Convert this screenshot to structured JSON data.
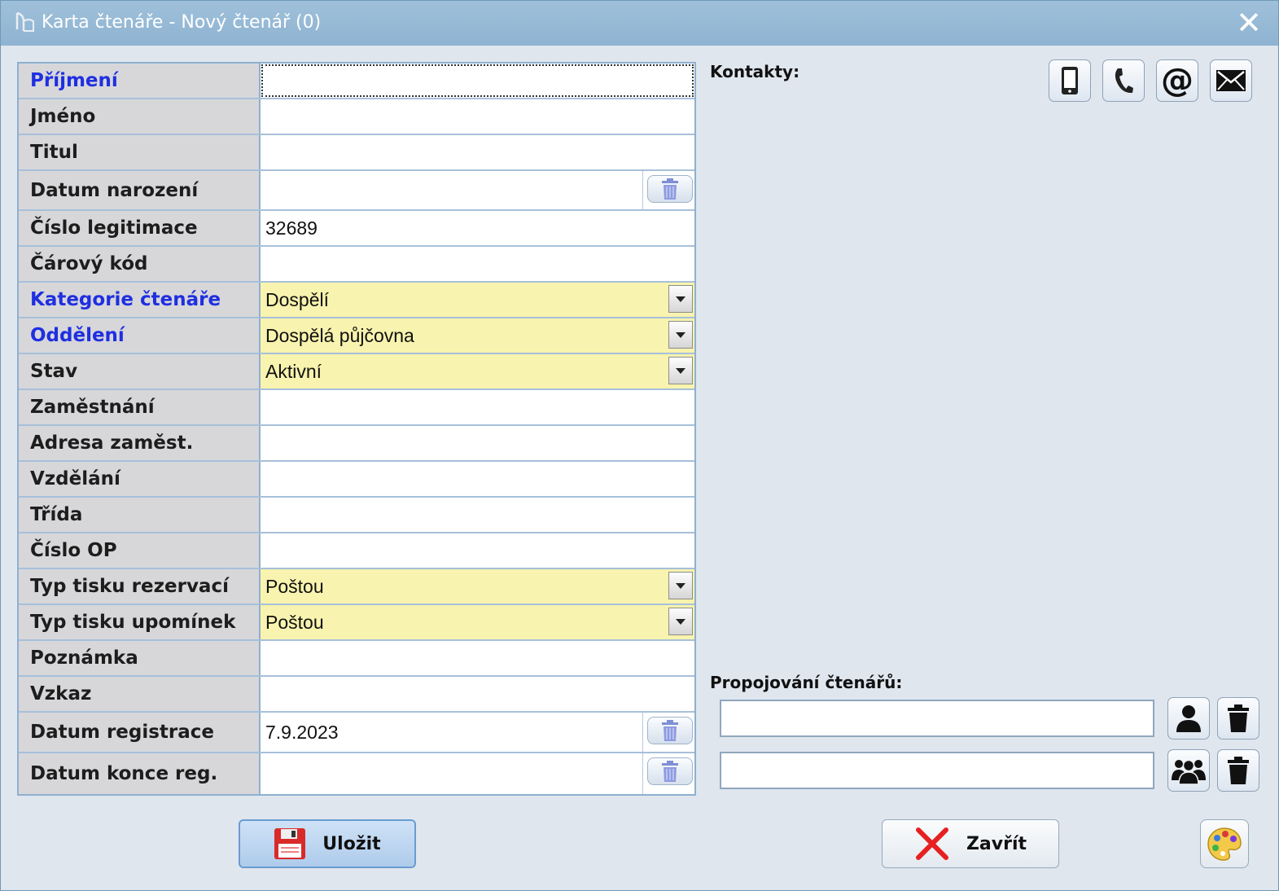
{
  "window": {
    "title": "Karta čtenáře - Nový čtenář (0)",
    "close_glyph": "✕"
  },
  "form": {
    "rows": [
      {
        "label": "Příjmení",
        "value": "",
        "required": true,
        "type": "text",
        "focused": true
      },
      {
        "label": "Jméno",
        "value": "",
        "type": "text"
      },
      {
        "label": "Titul",
        "value": "",
        "type": "text"
      },
      {
        "label": "Datum narození",
        "value": "",
        "type": "date"
      },
      {
        "label": "Číslo legitimace",
        "value": "32689",
        "type": "text"
      },
      {
        "label": "Čárový kód",
        "value": "",
        "type": "text"
      },
      {
        "label": "Kategorie čtenáře",
        "value": "Dospělí",
        "required": true,
        "type": "select"
      },
      {
        "label": "Oddělení",
        "value": "Dospělá půjčovna",
        "required": true,
        "type": "select"
      },
      {
        "label": "Stav",
        "value": "Aktivní",
        "type": "select"
      },
      {
        "label": "Zaměstnání",
        "value": "",
        "type": "text"
      },
      {
        "label": "Adresa zaměst.",
        "value": "",
        "type": "text"
      },
      {
        "label": "Vzdělání",
        "value": "",
        "type": "text"
      },
      {
        "label": "Třída",
        "value": "",
        "type": "text"
      },
      {
        "label": "Číslo OP",
        "value": "",
        "type": "text"
      },
      {
        "label": "Typ tisku rezervací",
        "value": "Poštou",
        "type": "select"
      },
      {
        "label": "Typ tisku upomínek",
        "value": "Poštou",
        "type": "select"
      },
      {
        "label": "Poznámka",
        "value": "",
        "type": "text"
      },
      {
        "label": "Vzkaz",
        "value": "",
        "type": "text"
      },
      {
        "label": "Datum registrace",
        "value": "7.9.2023",
        "type": "date"
      },
      {
        "label": "Datum konce reg.",
        "value": "",
        "type": "date"
      }
    ]
  },
  "contacts": {
    "label": "Kontakty:",
    "buttons": [
      "mobile-phone-icon",
      "phone-handset-icon",
      "at-sign-icon",
      "envelope-icon"
    ]
  },
  "linking": {
    "label": "Propojování čtenářů:",
    "reader_value": "",
    "group_value": ""
  },
  "buttons": {
    "save_label": "Uložit",
    "close_label": "Zavřít"
  },
  "colors": {
    "required_label": "#1f2fe0",
    "select_bg": "#f8f3ae",
    "titlebar": "#8eb3d1",
    "save_bg": "#aecbeb",
    "close_x": "#e62020"
  }
}
